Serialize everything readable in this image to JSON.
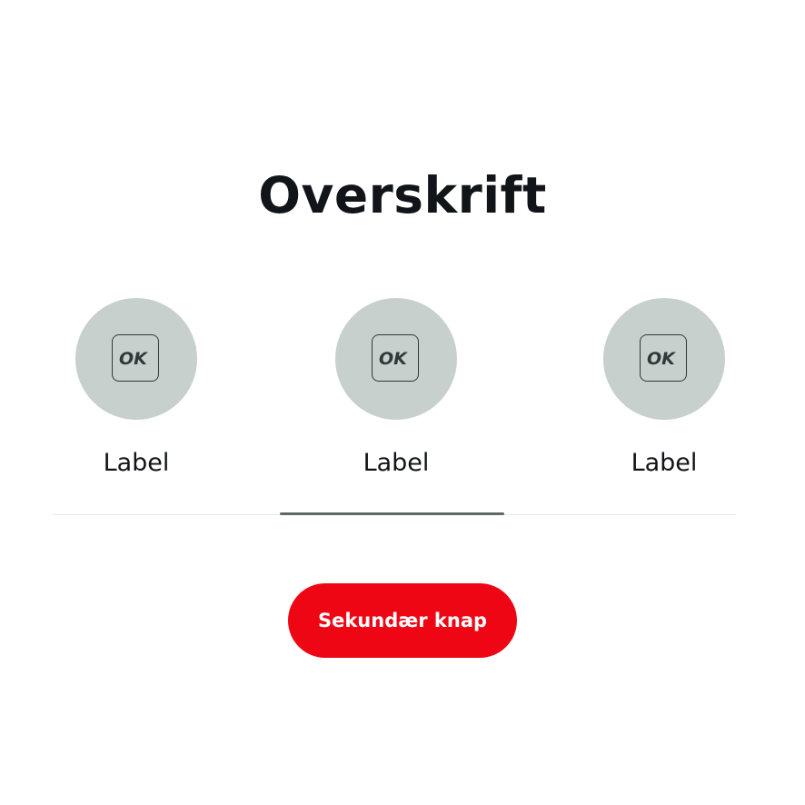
{
  "header": {
    "title": "Overskrift"
  },
  "tabs": [
    {
      "label": "Label",
      "icon": "ok-logo-icon",
      "icon_text": "OK"
    },
    {
      "label": "Label",
      "icon": "ok-logo-icon",
      "icon_text": "OK"
    },
    {
      "label": "Label",
      "icon": "ok-logo-icon",
      "icon_text": "OK"
    }
  ],
  "active_tab_index": 1,
  "secondary_button": {
    "label": "Sekundær knap"
  },
  "colors": {
    "accent": "#ee0614",
    "tile_background": "#c7d0cc",
    "icon_stroke": "#2f3a38",
    "active_indicator": "#5f6968",
    "text": "#111418"
  }
}
